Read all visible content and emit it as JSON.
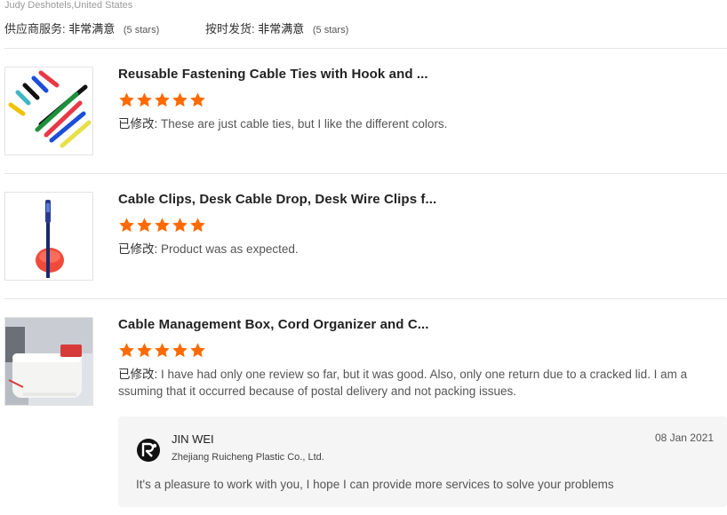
{
  "header": {
    "reviewer": "Judy Deshotels,United States",
    "supplier_service_label": "供应商服务:",
    "supplier_service_value": "非常满意",
    "supplier_service_stars": "(5 stars)",
    "on_time_label": "按时发货:",
    "on_time_value": "非常满意",
    "on_time_stars": "(5 stars)"
  },
  "colors": {
    "star": "#ff6a00",
    "divider": "#e5e5e5",
    "reply_bg": "#f5f5f5"
  },
  "reviews": [
    {
      "title": "Reusable Fastening Cable Ties with Hook and ...",
      "rating": 5,
      "comment_prefix": "已修改:",
      "comment": " These are just cable ties, but I like the different colors.",
      "thumb_icon": "colorful-cable-ties"
    },
    {
      "title": "Cable Clips, Desk Cable Drop, Desk Wire Clips f...",
      "rating": 5,
      "comment_prefix": "已修改:",
      "comment": " Product was as expected.",
      "thumb_icon": "cable-clip"
    },
    {
      "title": "Cable Management Box, Cord Organizer and C...",
      "rating": 5,
      "comment_prefix": "已修改:",
      "comment": " I have had only one review so far, but it was good.  Also, only one return due to a cracked lid.  I am a ssuming that it occurred because of postal delivery and not packing issues.",
      "thumb_icon": "cable-box"
    }
  ],
  "reply": {
    "name": "JIN WEI",
    "company": "Zhejiang Ruicheng Plastic Co., Ltd.",
    "date": "08 Jan 2021",
    "text": "It's a pleasure to work with you, I hope I can provide more services to solve your problems",
    "logo_icon": "company-logo"
  }
}
